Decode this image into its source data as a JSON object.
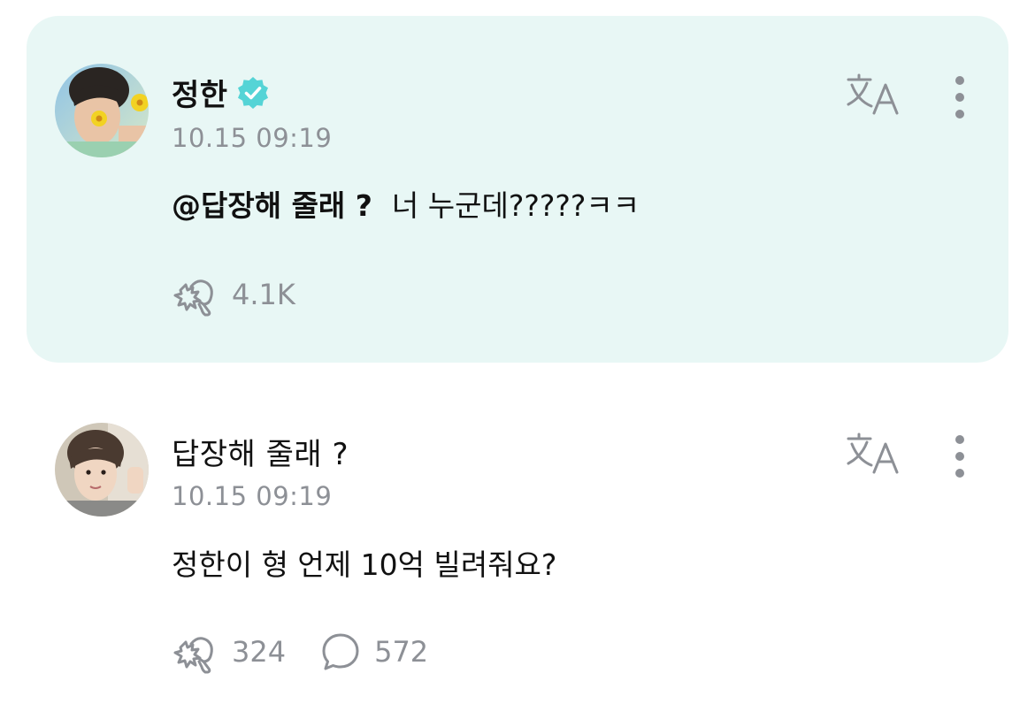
{
  "posts": [
    {
      "author": "정한",
      "verified": true,
      "timestamp": "10.15 09:19",
      "mention": "@답장해 줄래 ?",
      "text": "너 누군데?????ㅋㅋ",
      "like_count": "4.1K",
      "highlighted": true
    },
    {
      "author": "답장해 줄래 ?",
      "verified": false,
      "timestamp": "10.15 09:19",
      "text": "정한이 형 언제 10억 빌려줘요?",
      "like_count": "324",
      "comment_count": "572",
      "highlighted": false
    }
  ],
  "colors": {
    "highlight_bg": "#e8f7f5",
    "verified_badge": "#55d4d6",
    "icon_gray": "#8d9096",
    "text_primary": "#111111"
  },
  "icons": {
    "translate": "translate-icon",
    "more": "more-vertical-icon",
    "like": "like-hand-icon",
    "comment": "comment-bubble-icon",
    "verified": "verified-badge-icon"
  }
}
